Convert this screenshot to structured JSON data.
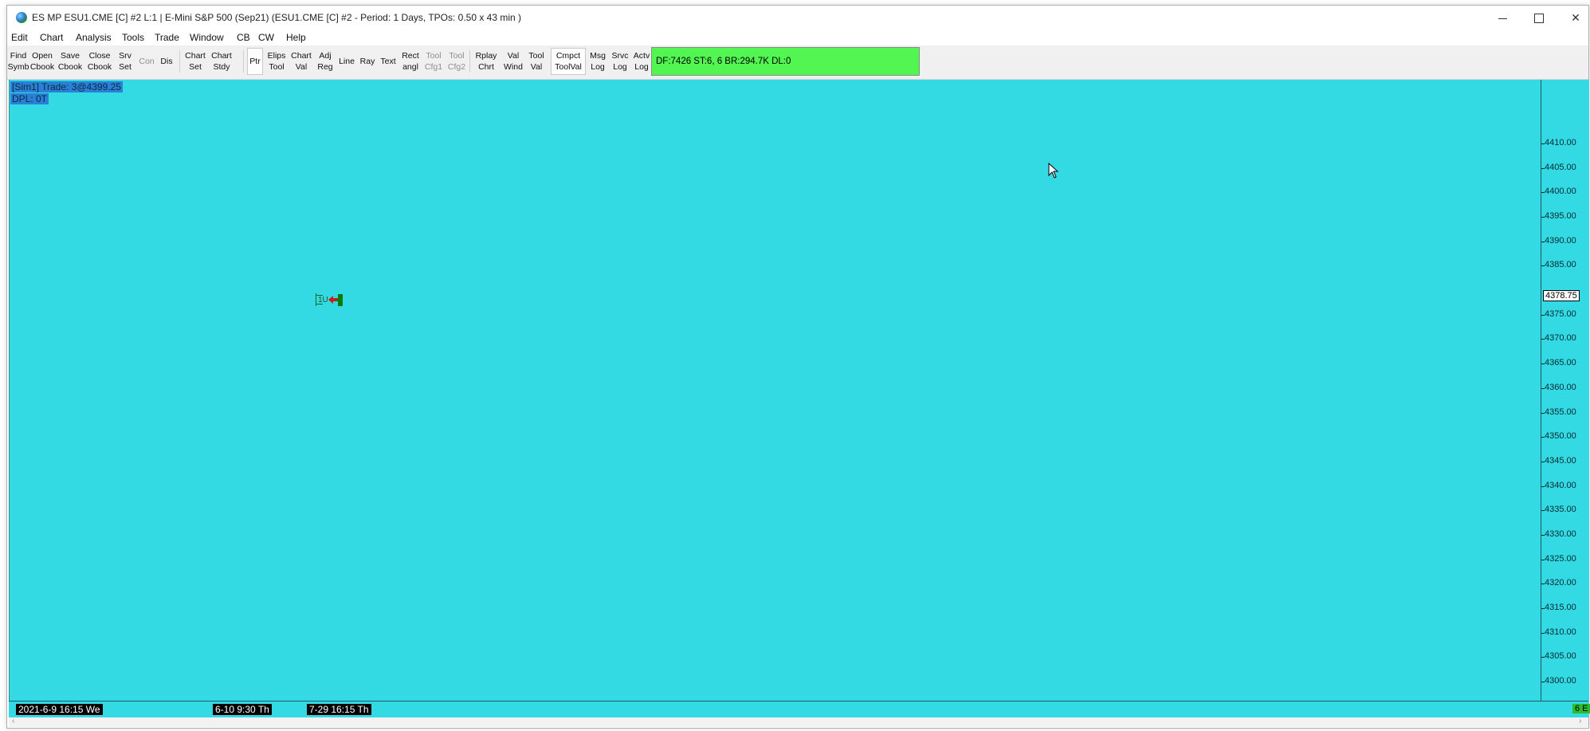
{
  "window": {
    "title": "ES MP ESU1.CME [C]  #2 L:1 | E-Mini S&P 500 (Sep21) (ESU1.CME [C]  #2 - Period: 1 Days, TPOs: 0.50 x 43 min  )",
    "minimize_glyph": "—",
    "close_glyph": "✕"
  },
  "menu": [
    "Edit",
    "Chart",
    "Analysis",
    "Tools",
    "Trade",
    "Window",
    "CB",
    "CW",
    "Help"
  ],
  "toolbar": {
    "buttons": [
      {
        "line1": "Find",
        "line2": "Symb"
      },
      {
        "line1": "Open",
        "line2": "Cbook"
      },
      {
        "line1": "Save",
        "line2": "Cbook"
      },
      {
        "line1": "Close",
        "line2": "Cbook"
      },
      {
        "line1": "Srv",
        "line2": "Set"
      },
      {
        "line1": "Con",
        "line2": ""
      },
      {
        "line1": "Dis",
        "line2": ""
      },
      {
        "line1": "Chart",
        "line2": "Set"
      },
      {
        "line1": "Chart",
        "line2": "Stdy"
      },
      {
        "line1": "Ptr",
        "line2": ""
      },
      {
        "line1": "Elips",
        "line2": "Tool"
      },
      {
        "line1": "Chart",
        "line2": "Val"
      },
      {
        "line1": "Adj",
        "line2": "Reg"
      },
      {
        "line1": "Line",
        "line2": ""
      },
      {
        "line1": "Ray",
        "line2": ""
      },
      {
        "line1": "Text",
        "line2": ""
      },
      {
        "line1": "Rect",
        "line2": "angl"
      },
      {
        "line1": "Tool",
        "line2": "Cfg1"
      },
      {
        "line1": "Tool",
        "line2": "Cfg2"
      },
      {
        "line1": "Rplay",
        "line2": "Chrt"
      },
      {
        "line1": "Val",
        "line2": "Wind"
      },
      {
        "line1": "Tool",
        "line2": "Val"
      },
      {
        "line1": "Cmpct",
        "line2": "ToolVal"
      },
      {
        "line1": "Msg",
        "line2": "Log"
      },
      {
        "line1": "Srvc",
        "line2": "Log"
      },
      {
        "line1": "Actv",
        "line2": "Log"
      }
    ],
    "status_text": "DF:7426  ST:6, 6  BR:294.7K  DL:0",
    "status_color": "#52f552"
  },
  "chart": {
    "background": "#33d9e3",
    "info_line1": "[Sim1]  Trade: 3@4399.25",
    "info_line2": "DPL: 0T",
    "tpo_letters": "1U",
    "price_ticks": [
      "4410.00",
      "4405.00",
      "4400.00",
      "4395.00",
      "4390.00",
      "4385.00",
      "4375.00",
      "4370.00",
      "4365.00",
      "4360.00",
      "4355.00",
      "4350.00",
      "4345.00",
      "4340.00",
      "4335.00",
      "4330.00",
      "4325.00",
      "4320.00",
      "4315.00",
      "4310.00",
      "4305.00",
      "4300.00"
    ],
    "current_price": "4378.75",
    "time_labels": [
      "2021-6-9  16:15 We",
      "6-10  9:30 Th",
      "7-29  16:15 Th"
    ],
    "corner_badge": "6 E"
  },
  "chart_data": {
    "type": "table",
    "title": "",
    "ylabel": "",
    "ylim": [
      4298,
      4413
    ],
    "y_ticks": [
      4410,
      4405,
      4400,
      4395,
      4390,
      4385,
      4375,
      4370,
      4365,
      4360,
      4355,
      4350,
      4345,
      4340,
      4335,
      4330,
      4325,
      4320,
      4315,
      4310,
      4305,
      4300
    ],
    "current_price": 4378.75,
    "last_trade": "3@4399.25"
  },
  "scrollbar": {
    "left": "‹",
    "right": "›"
  }
}
